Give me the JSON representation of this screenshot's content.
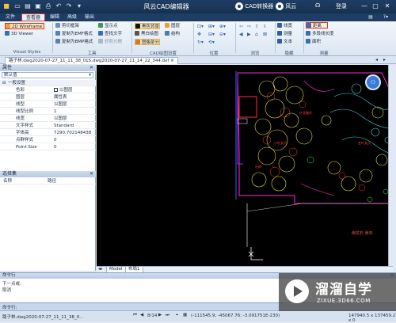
{
  "titlebar": {
    "title": "风云CAD编辑器",
    "converter": "CAD转换器",
    "user": "风云",
    "login": "登录"
  },
  "menu": {
    "tabs": [
      "文件",
      "查看器",
      "编辑",
      "高级",
      "输出"
    ],
    "active_index": 1
  },
  "ribbon": {
    "visual_styles": {
      "items": [
        "2D Wireframe",
        "3D Viewer"
      ],
      "group": "Visual Styles"
    },
    "tools": {
      "items": [
        "剪切框架",
        "复制为EMF格式",
        "复制为BMP格式",
        "显示点",
        "查找文字",
        "修剪光栅"
      ],
      "group": "工具"
    },
    "cad_settings": {
      "items": [
        "黑色背景",
        "黑白绘图",
        "图像部分",
        "图层",
        "结构"
      ],
      "group": "CAD绘图设置"
    },
    "position": {
      "group": "位置"
    },
    "browse": {
      "group": "浏览"
    },
    "hide": {
      "items": [
        "线宽",
        "测量",
        "文本"
      ],
      "group": "隐藏"
    },
    "measure": {
      "items": [
        "距离",
        "多段线长度",
        "面积"
      ],
      "group": "测量"
    }
  },
  "document": {
    "tab_label": "路子林.dwg2020-07-27_11_11_38_015.dwg2020-07-27_11_14_22_344.dxf"
  },
  "properties": {
    "header": "属性",
    "dropdown": "默认值",
    "section": "一般设置",
    "rows": [
      {
        "key": "色彩",
        "value": "以图层",
        "swatch": true
      },
      {
        "key": "图层",
        "value": "属性表"
      },
      {
        "key": "线型",
        "value": "以图层"
      },
      {
        "key": "线型比例",
        "value": "1"
      },
      {
        "key": "线宽",
        "value": "以图层"
      },
      {
        "key": "文字样式",
        "value": "Standard"
      },
      {
        "key": "字体高",
        "value": "7290.702148438"
      },
      {
        "key": "点群样式",
        "value": "0"
      },
      {
        "key": "Point Size",
        "value": "0"
      }
    ]
  },
  "layers": {
    "header": "选择集",
    "col_name": "名称",
    "col_path": "路径"
  },
  "layout_tabs": [
    "Model",
    "布局1"
  ],
  "command": {
    "header": "命令行",
    "lines": [
      "下一点或:",
      "取消"
    ],
    "input_label": "命令行:"
  },
  "status": {
    "file": "路子林.dwg2020-07-27_11_11_38_0...",
    "page": "8/14",
    "coords": "(-111545.9; -45067.76; -3.091751E-230)",
    "size": "147940.5 x 137459.2 x 0"
  },
  "watermark": {
    "brand": "溜溜自学",
    "url": "ZIXUE.3D66.COM"
  },
  "drawing": {
    "label": "雨花石 景石"
  }
}
